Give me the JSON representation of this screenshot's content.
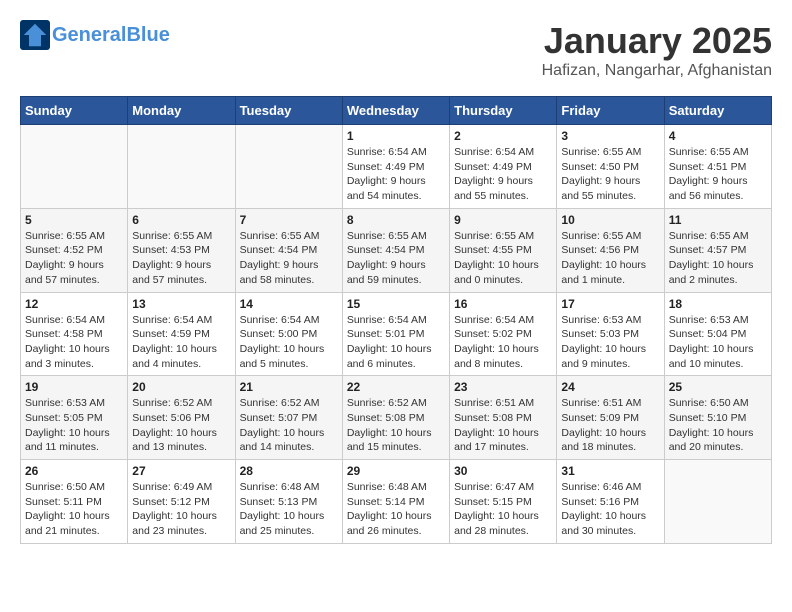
{
  "header": {
    "logo_line1": "General",
    "logo_line2": "Blue",
    "month_title": "January 2025",
    "location": "Hafizan, Nangarhar, Afghanistan"
  },
  "weekdays": [
    "Sunday",
    "Monday",
    "Tuesday",
    "Wednesday",
    "Thursday",
    "Friday",
    "Saturday"
  ],
  "weeks": [
    [
      {
        "day": "",
        "info": ""
      },
      {
        "day": "",
        "info": ""
      },
      {
        "day": "",
        "info": ""
      },
      {
        "day": "1",
        "info": "Sunrise: 6:54 AM\nSunset: 4:49 PM\nDaylight: 9 hours\nand 54 minutes."
      },
      {
        "day": "2",
        "info": "Sunrise: 6:54 AM\nSunset: 4:49 PM\nDaylight: 9 hours\nand 55 minutes."
      },
      {
        "day": "3",
        "info": "Sunrise: 6:55 AM\nSunset: 4:50 PM\nDaylight: 9 hours\nand 55 minutes."
      },
      {
        "day": "4",
        "info": "Sunrise: 6:55 AM\nSunset: 4:51 PM\nDaylight: 9 hours\nand 56 minutes."
      }
    ],
    [
      {
        "day": "5",
        "info": "Sunrise: 6:55 AM\nSunset: 4:52 PM\nDaylight: 9 hours\nand 57 minutes."
      },
      {
        "day": "6",
        "info": "Sunrise: 6:55 AM\nSunset: 4:53 PM\nDaylight: 9 hours\nand 57 minutes."
      },
      {
        "day": "7",
        "info": "Sunrise: 6:55 AM\nSunset: 4:54 PM\nDaylight: 9 hours\nand 58 minutes."
      },
      {
        "day": "8",
        "info": "Sunrise: 6:55 AM\nSunset: 4:54 PM\nDaylight: 9 hours\nand 59 minutes."
      },
      {
        "day": "9",
        "info": "Sunrise: 6:55 AM\nSunset: 4:55 PM\nDaylight: 10 hours\nand 0 minutes."
      },
      {
        "day": "10",
        "info": "Sunrise: 6:55 AM\nSunset: 4:56 PM\nDaylight: 10 hours\nand 1 minute."
      },
      {
        "day": "11",
        "info": "Sunrise: 6:55 AM\nSunset: 4:57 PM\nDaylight: 10 hours\nand 2 minutes."
      }
    ],
    [
      {
        "day": "12",
        "info": "Sunrise: 6:54 AM\nSunset: 4:58 PM\nDaylight: 10 hours\nand 3 minutes."
      },
      {
        "day": "13",
        "info": "Sunrise: 6:54 AM\nSunset: 4:59 PM\nDaylight: 10 hours\nand 4 minutes."
      },
      {
        "day": "14",
        "info": "Sunrise: 6:54 AM\nSunset: 5:00 PM\nDaylight: 10 hours\nand 5 minutes."
      },
      {
        "day": "15",
        "info": "Sunrise: 6:54 AM\nSunset: 5:01 PM\nDaylight: 10 hours\nand 6 minutes."
      },
      {
        "day": "16",
        "info": "Sunrise: 6:54 AM\nSunset: 5:02 PM\nDaylight: 10 hours\nand 8 minutes."
      },
      {
        "day": "17",
        "info": "Sunrise: 6:53 AM\nSunset: 5:03 PM\nDaylight: 10 hours\nand 9 minutes."
      },
      {
        "day": "18",
        "info": "Sunrise: 6:53 AM\nSunset: 5:04 PM\nDaylight: 10 hours\nand 10 minutes."
      }
    ],
    [
      {
        "day": "19",
        "info": "Sunrise: 6:53 AM\nSunset: 5:05 PM\nDaylight: 10 hours\nand 11 minutes."
      },
      {
        "day": "20",
        "info": "Sunrise: 6:52 AM\nSunset: 5:06 PM\nDaylight: 10 hours\nand 13 minutes."
      },
      {
        "day": "21",
        "info": "Sunrise: 6:52 AM\nSunset: 5:07 PM\nDaylight: 10 hours\nand 14 minutes."
      },
      {
        "day": "22",
        "info": "Sunrise: 6:52 AM\nSunset: 5:08 PM\nDaylight: 10 hours\nand 15 minutes."
      },
      {
        "day": "23",
        "info": "Sunrise: 6:51 AM\nSunset: 5:08 PM\nDaylight: 10 hours\nand 17 minutes."
      },
      {
        "day": "24",
        "info": "Sunrise: 6:51 AM\nSunset: 5:09 PM\nDaylight: 10 hours\nand 18 minutes."
      },
      {
        "day": "25",
        "info": "Sunrise: 6:50 AM\nSunset: 5:10 PM\nDaylight: 10 hours\nand 20 minutes."
      }
    ],
    [
      {
        "day": "26",
        "info": "Sunrise: 6:50 AM\nSunset: 5:11 PM\nDaylight: 10 hours\nand 21 minutes."
      },
      {
        "day": "27",
        "info": "Sunrise: 6:49 AM\nSunset: 5:12 PM\nDaylight: 10 hours\nand 23 minutes."
      },
      {
        "day": "28",
        "info": "Sunrise: 6:48 AM\nSunset: 5:13 PM\nDaylight: 10 hours\nand 25 minutes."
      },
      {
        "day": "29",
        "info": "Sunrise: 6:48 AM\nSunset: 5:14 PM\nDaylight: 10 hours\nand 26 minutes."
      },
      {
        "day": "30",
        "info": "Sunrise: 6:47 AM\nSunset: 5:15 PM\nDaylight: 10 hours\nand 28 minutes."
      },
      {
        "day": "31",
        "info": "Sunrise: 6:46 AM\nSunset: 5:16 PM\nDaylight: 10 hours\nand 30 minutes."
      },
      {
        "day": "",
        "info": ""
      }
    ]
  ]
}
